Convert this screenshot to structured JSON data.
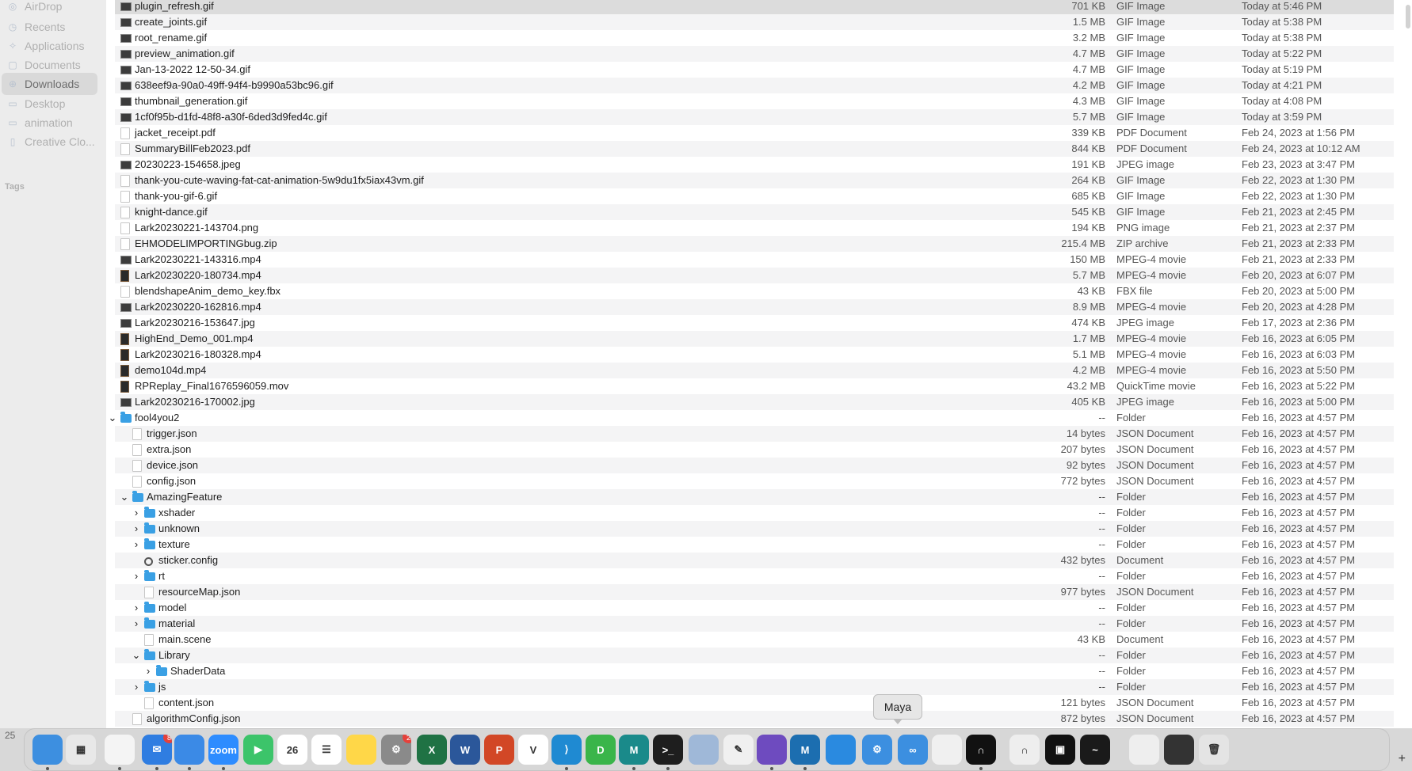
{
  "sidebar": {
    "items": [
      {
        "label": "AirDrop",
        "icon": "airdrop-icon",
        "selected": false
      },
      {
        "label": "Recents",
        "icon": "clock-icon",
        "selected": false
      },
      {
        "label": "Applications",
        "icon": "applications-icon",
        "selected": false
      },
      {
        "label": "Documents",
        "icon": "document-icon",
        "selected": false
      },
      {
        "label": "Downloads",
        "icon": "download-icon",
        "selected": true
      },
      {
        "label": "Desktop",
        "icon": "desktop-icon",
        "selected": false
      },
      {
        "label": "animation",
        "icon": "folder-icon",
        "selected": false
      },
      {
        "label": "Creative Clo...",
        "icon": "file-icon",
        "selected": false
      }
    ],
    "tags_label": "Tags"
  },
  "files": [
    {
      "name": "plugin_refresh.gif",
      "size": "701 KB",
      "kind": "GIF Image",
      "date": "Today at 5:46 PM",
      "icon": "img",
      "depth": 0,
      "disc": "",
      "selected": true
    },
    {
      "name": "create_joints.gif",
      "size": "1.5 MB",
      "kind": "GIF Image",
      "date": "Today at 5:38 PM",
      "icon": "img",
      "depth": 0,
      "disc": ""
    },
    {
      "name": "root_rename.gif",
      "size": "3.2 MB",
      "kind": "GIF Image",
      "date": "Today at 5:38 PM",
      "icon": "img",
      "depth": 0,
      "disc": ""
    },
    {
      "name": "preview_animation.gif",
      "size": "4.7 MB",
      "kind": "GIF Image",
      "date": "Today at 5:22 PM",
      "icon": "img",
      "depth": 0,
      "disc": ""
    },
    {
      "name": "Jan-13-2022 12-50-34.gif",
      "size": "4.7 MB",
      "kind": "GIF Image",
      "date": "Today at 5:19 PM",
      "icon": "img",
      "depth": 0,
      "disc": ""
    },
    {
      "name": "638eef9a-90a0-49ff-94f4-b9990a53bc96.gif",
      "size": "4.2 MB",
      "kind": "GIF Image",
      "date": "Today at 4:21 PM",
      "icon": "img",
      "depth": 0,
      "disc": ""
    },
    {
      "name": "thumbnail_generation.gif",
      "size": "4.3 MB",
      "kind": "GIF Image",
      "date": "Today at 4:08 PM",
      "icon": "img",
      "depth": 0,
      "disc": ""
    },
    {
      "name": "1cf0f95b-d1fd-48f8-a30f-6ded3d9fed4c.gif",
      "size": "5.7 MB",
      "kind": "GIF Image",
      "date": "Today at 3:59 PM",
      "icon": "img",
      "depth": 0,
      "disc": ""
    },
    {
      "name": "jacket_receipt.pdf",
      "size": "339 KB",
      "kind": "PDF Document",
      "date": "Feb 24, 2023 at 1:56 PM",
      "icon": "doc",
      "depth": 0,
      "disc": ""
    },
    {
      "name": "SummaryBillFeb2023.pdf",
      "size": "844 KB",
      "kind": "PDF Document",
      "date": "Feb 24, 2023 at 10:12 AM",
      "icon": "doc",
      "depth": 0,
      "disc": ""
    },
    {
      "name": "20230223-154658.jpeg",
      "size": "191 KB",
      "kind": "JPEG image",
      "date": "Feb 23, 2023 at 3:47 PM",
      "icon": "img",
      "depth": 0,
      "disc": ""
    },
    {
      "name": "thank-you-cute-waving-fat-cat-animation-5w9du1fx5iax43vm.gif",
      "size": "264 KB",
      "kind": "GIF Image",
      "date": "Feb 22, 2023 at 1:30 PM",
      "icon": "doc",
      "depth": 0,
      "disc": ""
    },
    {
      "name": "thank-you-gif-6.gif",
      "size": "685 KB",
      "kind": "GIF Image",
      "date": "Feb 22, 2023 at 1:30 PM",
      "icon": "doc",
      "depth": 0,
      "disc": ""
    },
    {
      "name": "knight-dance.gif",
      "size": "545 KB",
      "kind": "GIF Image",
      "date": "Feb 21, 2023 at 2:45 PM",
      "icon": "doc",
      "depth": 0,
      "disc": ""
    },
    {
      "name": "Lark20230221-143704.png",
      "size": "194 KB",
      "kind": "PNG image",
      "date": "Feb 21, 2023 at 2:37 PM",
      "icon": "doc",
      "depth": 0,
      "disc": ""
    },
    {
      "name": "EHMODELIMPORTINGbug.zip",
      "size": "215.4 MB",
      "kind": "ZIP archive",
      "date": "Feb 21, 2023 at 2:33 PM",
      "icon": "doc",
      "depth": 0,
      "disc": ""
    },
    {
      "name": "Lark20230221-143316.mp4",
      "size": "150 MB",
      "kind": "MPEG-4 movie",
      "date": "Feb 21, 2023 at 2:33 PM",
      "icon": "img",
      "depth": 0,
      "disc": ""
    },
    {
      "name": "Lark20230220-180734.mp4",
      "size": "5.7 MB",
      "kind": "MPEG-4 movie",
      "date": "Feb 20, 2023 at 6:07 PM",
      "icon": "vid",
      "depth": 0,
      "disc": ""
    },
    {
      "name": "blendshapeAnim_demo_key.fbx",
      "size": "43 KB",
      "kind": "FBX file",
      "date": "Feb 20, 2023 at 5:00 PM",
      "icon": "doc",
      "depth": 0,
      "disc": ""
    },
    {
      "name": "Lark20230220-162816.mp4",
      "size": "8.9 MB",
      "kind": "MPEG-4 movie",
      "date": "Feb 20, 2023 at 4:28 PM",
      "icon": "img",
      "depth": 0,
      "disc": ""
    },
    {
      "name": "Lark20230216-153647.jpg",
      "size": "474 KB",
      "kind": "JPEG image",
      "date": "Feb 17, 2023 at 2:36 PM",
      "icon": "img",
      "depth": 0,
      "disc": ""
    },
    {
      "name": "HighEnd_Demo_001.mp4",
      "size": "1.7 MB",
      "kind": "MPEG-4 movie",
      "date": "Feb 16, 2023 at 6:05 PM",
      "icon": "vid",
      "depth": 0,
      "disc": ""
    },
    {
      "name": "Lark20230216-180328.mp4",
      "size": "5.1 MB",
      "kind": "MPEG-4 movie",
      "date": "Feb 16, 2023 at 6:03 PM",
      "icon": "vid",
      "depth": 0,
      "disc": ""
    },
    {
      "name": "demo104d.mp4",
      "size": "4.2 MB",
      "kind": "MPEG-4 movie",
      "date": "Feb 16, 2023 at 5:50 PM",
      "icon": "vid",
      "depth": 0,
      "disc": ""
    },
    {
      "name": "RPReplay_Final1676596059.mov",
      "size": "43.2 MB",
      "kind": "QuickTime movie",
      "date": "Feb 16, 2023 at 5:22 PM",
      "icon": "vid",
      "depth": 0,
      "disc": ""
    },
    {
      "name": "Lark20230216-170002.jpg",
      "size": "405 KB",
      "kind": "JPEG image",
      "date": "Feb 16, 2023 at 5:00 PM",
      "icon": "img",
      "depth": 0,
      "disc": ""
    },
    {
      "name": "fool4you2",
      "size": "--",
      "kind": "Folder",
      "date": "Feb 16, 2023 at 4:57 PM",
      "icon": "folder",
      "depth": 0,
      "disc": "v"
    },
    {
      "name": "trigger.json",
      "size": "14 bytes",
      "kind": "JSON Document",
      "date": "Feb 16, 2023 at 4:57 PM",
      "icon": "doc",
      "depth": 1,
      "disc": ""
    },
    {
      "name": "extra.json",
      "size": "207 bytes",
      "kind": "JSON Document",
      "date": "Feb 16, 2023 at 4:57 PM",
      "icon": "doc",
      "depth": 1,
      "disc": ""
    },
    {
      "name": "device.json",
      "size": "92 bytes",
      "kind": "JSON Document",
      "date": "Feb 16, 2023 at 4:57 PM",
      "icon": "doc",
      "depth": 1,
      "disc": ""
    },
    {
      "name": "config.json",
      "size": "772 bytes",
      "kind": "JSON Document",
      "date": "Feb 16, 2023 at 4:57 PM",
      "icon": "doc",
      "depth": 1,
      "disc": ""
    },
    {
      "name": "AmazingFeature",
      "size": "--",
      "kind": "Folder",
      "date": "Feb 16, 2023 at 4:57 PM",
      "icon": "folder",
      "depth": 1,
      "disc": "v"
    },
    {
      "name": "xshader",
      "size": "--",
      "kind": "Folder",
      "date": "Feb 16, 2023 at 4:57 PM",
      "icon": "folder",
      "depth": 2,
      "disc": ">"
    },
    {
      "name": "unknown",
      "size": "--",
      "kind": "Folder",
      "date": "Feb 16, 2023 at 4:57 PM",
      "icon": "folder",
      "depth": 2,
      "disc": ">"
    },
    {
      "name": "texture",
      "size": "--",
      "kind": "Folder",
      "date": "Feb 16, 2023 at 4:57 PM",
      "icon": "folder",
      "depth": 2,
      "disc": ">"
    },
    {
      "name": "sticker.config",
      "size": "432 bytes",
      "kind": "Document",
      "date": "Feb 16, 2023 at 4:57 PM",
      "icon": "gear",
      "depth": 2,
      "disc": ""
    },
    {
      "name": "rt",
      "size": "--",
      "kind": "Folder",
      "date": "Feb 16, 2023 at 4:57 PM",
      "icon": "folder",
      "depth": 2,
      "disc": ">"
    },
    {
      "name": "resourceMap.json",
      "size": "977 bytes",
      "kind": "JSON Document",
      "date": "Feb 16, 2023 at 4:57 PM",
      "icon": "doc",
      "depth": 2,
      "disc": ""
    },
    {
      "name": "model",
      "size": "--",
      "kind": "Folder",
      "date": "Feb 16, 2023 at 4:57 PM",
      "icon": "folder",
      "depth": 2,
      "disc": ">"
    },
    {
      "name": "material",
      "size": "--",
      "kind": "Folder",
      "date": "Feb 16, 2023 at 4:57 PM",
      "icon": "folder",
      "depth": 2,
      "disc": ">"
    },
    {
      "name": "main.scene",
      "size": "43 KB",
      "kind": "Document",
      "date": "Feb 16, 2023 at 4:57 PM",
      "icon": "doc",
      "depth": 2,
      "disc": ""
    },
    {
      "name": "Library",
      "size": "--",
      "kind": "Folder",
      "date": "Feb 16, 2023 at 4:57 PM",
      "icon": "folder",
      "depth": 2,
      "disc": "v"
    },
    {
      "name": "ShaderData",
      "size": "--",
      "kind": "Folder",
      "date": "Feb 16, 2023 at 4:57 PM",
      "icon": "folder",
      "depth": 3,
      "disc": ">"
    },
    {
      "name": "js",
      "size": "--",
      "kind": "Folder",
      "date": "Feb 16, 2023 at 4:57 PM",
      "icon": "folder",
      "depth": 2,
      "disc": ">"
    },
    {
      "name": "content.json",
      "size": "121 bytes",
      "kind": "JSON Document",
      "date": "Feb 16, 2023 at 4:57 PM",
      "icon": "doc",
      "depth": 2,
      "disc": ""
    },
    {
      "name": "algorithmConfig.json",
      "size": "872 bytes",
      "kind": "JSON Document",
      "date": "Feb 16, 2023 at 4:57 PM",
      "icon": "doc",
      "depth": 1,
      "disc": ""
    }
  ],
  "tooltip": "Maya",
  "corner_number": "25",
  "dock": [
    {
      "name": "finder-icon",
      "color": "#3d8fe0",
      "label": "",
      "dot": true
    },
    {
      "name": "launchpad-icon",
      "color": "#e8e8e8",
      "label": "▦",
      "dot": false
    },
    {
      "name": "chrome-icon",
      "color": "#f4f4f4",
      "label": "",
      "dot": true
    },
    {
      "name": "mail-icon",
      "color": "#2f7de1",
      "label": "✉",
      "badge": "8",
      "dot": true
    },
    {
      "name": "app-bird-icon",
      "color": "#3b8ae6",
      "label": "",
      "dot": true
    },
    {
      "name": "zoom-icon",
      "color": "#2d8cff",
      "label": "zoom",
      "dot": true
    },
    {
      "name": "facetime-icon",
      "color": "#3cc46a",
      "label": "▶",
      "dot": false
    },
    {
      "name": "calendar-icon",
      "color": "#ffffff",
      "label": "26",
      "dot": false
    },
    {
      "name": "reminders-icon",
      "color": "#ffffff",
      "label": "☰",
      "dot": false
    },
    {
      "name": "notes-icon",
      "color": "#ffd748",
      "label": "",
      "dot": false
    },
    {
      "name": "system-preferences-icon",
      "color": "#8a8a8a",
      "label": "⚙",
      "badge": "2",
      "dot": false
    },
    {
      "name": "excel-icon",
      "color": "#1f7244",
      "label": "X",
      "dot": false
    },
    {
      "name": "word-icon",
      "color": "#2b579a",
      "label": "W",
      "dot": false
    },
    {
      "name": "powerpoint-icon",
      "color": "#d24726",
      "label": "P",
      "dot": false
    },
    {
      "name": "app-v-icon",
      "color": "#ffffff",
      "label": "V",
      "dot": false
    },
    {
      "name": "vscode-icon",
      "color": "#1f8ad2",
      "label": "⟩",
      "dot": true
    },
    {
      "name": "app-d-icon",
      "color": "#3ab54a",
      "label": "D",
      "dot": false
    },
    {
      "name": "maya-icon",
      "color": "#1a8a8a",
      "label": "M",
      "dot": true
    },
    {
      "name": "terminal-icon",
      "color": "#1e1e1e",
      "label": ">_",
      "dot": true
    },
    {
      "name": "preview-icon",
      "color": "#9fb8d8",
      "label": "",
      "dot": false
    },
    {
      "name": "textedit-icon",
      "color": "#f0f0f0",
      "label": "✎",
      "dot": false
    },
    {
      "name": "github-icon",
      "color": "#6e4bbf",
      "label": "",
      "dot": true
    },
    {
      "name": "maya-alt-icon",
      "color": "#1c6eb0",
      "label": "M",
      "dot": true
    },
    {
      "name": "app-blue1-icon",
      "color": "#2a8ae0",
      "label": "",
      "dot": false
    },
    {
      "name": "app-blue2-icon",
      "color": "#3c8fe0",
      "label": "⚙",
      "dot": false
    },
    {
      "name": "app-blue3-icon",
      "color": "#3c8fe0",
      "label": "∞",
      "dot": false
    },
    {
      "name": "blender-icon",
      "color": "#f0f0f0",
      "label": "",
      "dot": false
    },
    {
      "name": "app-arch-icon",
      "color": "#111111",
      "label": "∩",
      "dot": true
    },
    {
      "name": "app-arch2-icon",
      "color": "#eeeeee",
      "label": "∩",
      "dot": false
    },
    {
      "name": "app-screen-icon",
      "color": "#111111",
      "label": "▣",
      "dot": false
    },
    {
      "name": "activity-monitor-icon",
      "color": "#1a1a1a",
      "label": "~",
      "dot": false
    },
    {
      "name": "window1-icon",
      "color": "#eeeeee",
      "label": "",
      "dot": false
    },
    {
      "name": "window2-icon",
      "color": "#333333",
      "label": "",
      "dot": false
    },
    {
      "name": "trash-icon",
      "color": "#e4e4e4",
      "label": "🗑",
      "dot": false
    }
  ]
}
